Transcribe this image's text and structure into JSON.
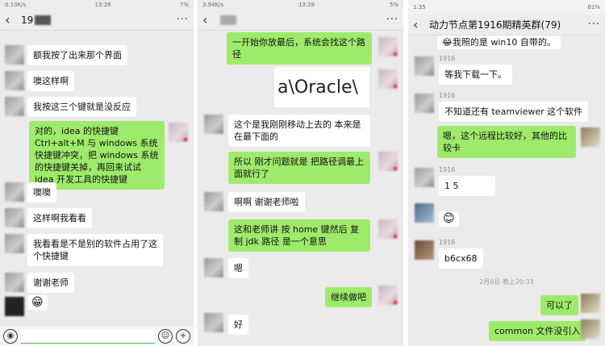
{
  "panel1": {
    "status_left": "0.10K/s",
    "status_time": "13:26",
    "status_right": "7%",
    "title": "19",
    "messages": [
      "额我按了出来那个界面",
      "噢这样啊",
      "我按这三个键就是没反应",
      "对的，idea 的快捷键 Ctrl+alt+M 与 windows 系统快捷键冲突，把 windows 系统的快捷键关掉，再回来试试 idea 开发工具的快捷键",
      "噢噢",
      "这样啊我看看",
      "我看看是不是别的软件占用了这个快捷键",
      "谢谢老师",
      "😁"
    ]
  },
  "panel2": {
    "status_left": "3.94K/s",
    "status_time": "13:28",
    "status_right": "5%",
    "messages": [
      "一开始你放最后，系统会找这个路径",
      "a\\Oracle\\",
      "这个是我刚刚移动上去的  本来是在最下面的",
      "所以  刚才问题就是 把路径调最上面就行了",
      "啊啊  谢谢老师啦",
      "这和老师讲  按 home 键然后  复制 jdk 路径 是一个意思",
      "嗯",
      "继续做吧",
      "好"
    ]
  },
  "panel3": {
    "status_time": "1:35",
    "status_right": "61%",
    "title": "动力节点第1916期精英群(79)",
    "top_partial": "😂我照的是 win10 自带的。",
    "nick_prefix": "1916",
    "time_label": "2月6日 晚上20:33",
    "messages": [
      "等我下载一下。",
      "不知道还有 teamviewer 这个软件",
      "嗯，这个远程比较好，其他的比较卡",
      "1 5",
      "😊",
      "b6cx68",
      "可以了",
      "common 文件没引入"
    ]
  }
}
